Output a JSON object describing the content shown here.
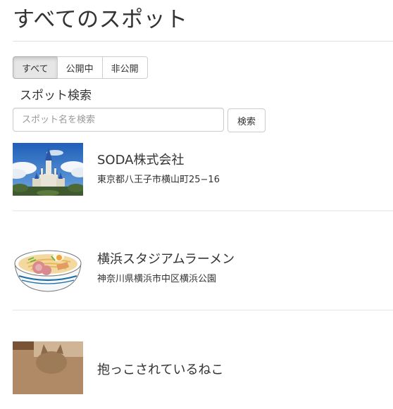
{
  "page": {
    "title": "すべてのスポット"
  },
  "filters": [
    {
      "label": "すべて",
      "active": true
    },
    {
      "label": "公開中",
      "active": false
    },
    {
      "label": "非公開",
      "active": false
    }
  ],
  "search": {
    "heading": "スポット検索",
    "placeholder": "スポット名を検索",
    "button_label": "検索"
  },
  "spots": [
    {
      "name": "SODA株式会社",
      "address": "東京都八王子市横山町25−16",
      "image": "castle-photo"
    },
    {
      "name": "横浜スタジアムラーメン",
      "address": "神奈川県横浜市中区横浜公園",
      "image": "ramen-bowl-illustration"
    },
    {
      "name": "抱っこされているねこ",
      "address": "",
      "image": "cat-photo"
    }
  ],
  "colors": {
    "border": "#cccccc",
    "active_filter_bg": "#e6e6e6",
    "divider": "#e4e4e4",
    "text": "#333333"
  }
}
